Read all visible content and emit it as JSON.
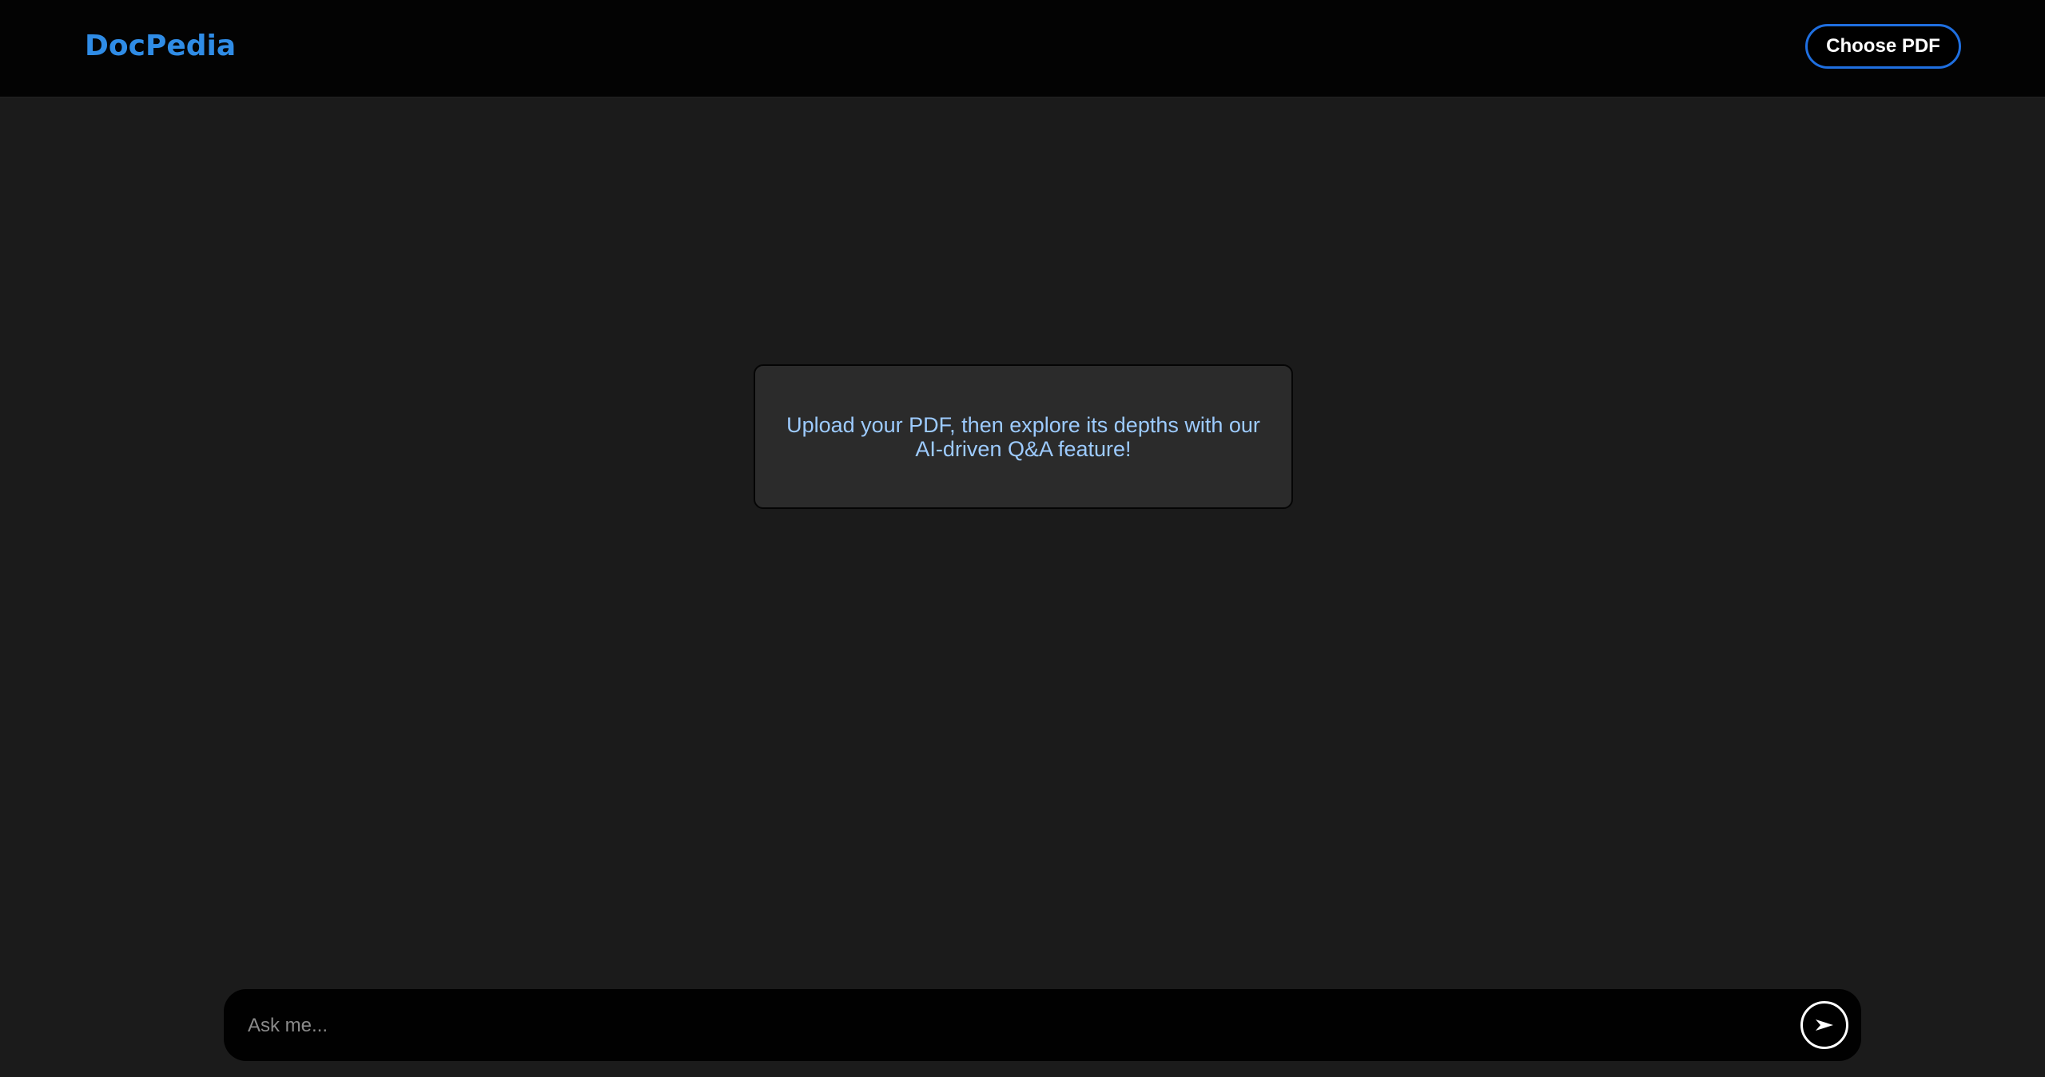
{
  "header": {
    "brand": "DocPedia",
    "choose_pdf_label": "Choose PDF"
  },
  "main": {
    "info_message": "Upload your PDF, then explore its depths with our AI-driven Q&A feature!"
  },
  "chat": {
    "input_value": "",
    "placeholder": "Ask me...",
    "send_icon": "send-arrow-icon"
  },
  "colors": {
    "accent": "#2f8ce6",
    "button_border": "#1f6fe0",
    "info_text": "#9dcbff",
    "background": "#1b1b1b",
    "header_background": "#030303"
  }
}
